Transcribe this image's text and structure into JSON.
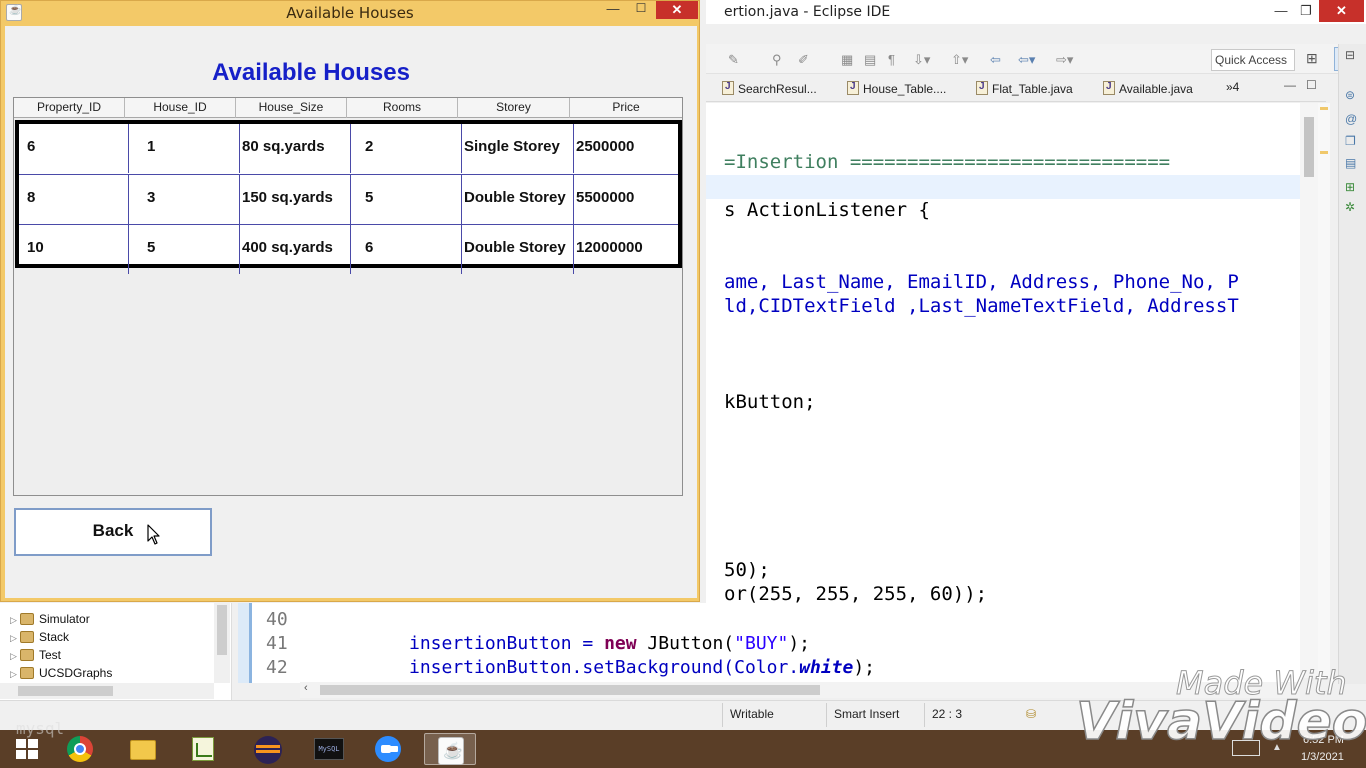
{
  "available_houses_window": {
    "title": "Available Houses",
    "heading": "Available Houses",
    "table": {
      "columns": [
        "Property_ID",
        "House_ID",
        "House_Size",
        "Rooms",
        "Storey",
        "Price"
      ],
      "rows": [
        [
          "6",
          "1",
          "80 sq.yards",
          "2",
          "Single Storey",
          "2500000"
        ],
        [
          "8",
          "3",
          "150 sq.yards",
          "5",
          "Double Storey",
          "5500000"
        ],
        [
          "10",
          "5",
          "400 sq.yards",
          "6",
          "Double Storey",
          "12000000"
        ]
      ]
    },
    "back_label": "Back",
    "controls": {
      "minimize": "—",
      "maximize": "☐",
      "close": "✕"
    }
  },
  "eclipse": {
    "title": "ertion.java - Eclipse IDE",
    "quick_access": "Quick Access",
    "tabs": [
      "SearchResul...",
      "House_Table....",
      "Flat_Table.java",
      "Available.java"
    ],
    "tabs_more": "»4",
    "editor_lines": [
      "=Insertion ============================",
      "s ActionListener {",
      "ame, Last_Name, EmailID, Address, Phone_No, P",
      "ld,CIDTextField ,Last_NameTextField, AddressT",
      "kButton;",
      "50);",
      "or(255, 255, 255, 60));"
    ],
    "bottom_code": {
      "line_numbers": [
        "40",
        "41",
        "42"
      ],
      "line41_a": "insertionButton = ",
      "line41_kw": "new",
      "line41_b": " JButton(",
      "line41_str": "\"BUY\"",
      "line41_c": ");",
      "line42_a": "insertionButton.setBackground(Color.",
      "line42_static": "white",
      "line42_b": ");"
    },
    "package_explorer": [
      "Simulator",
      "Stack",
      "Test",
      "UCSDGraphs"
    ],
    "status": {
      "writable": "Writable",
      "insert_mode": "Smart Insert",
      "position": "22 : 3"
    }
  },
  "taskbar": {
    "clock_time": "6:52 PM",
    "clock_date": "1/3/2021",
    "mysql_label": "MySQL"
  },
  "watermark": {
    "made_with": "Made With",
    "brand": "VivaVideo",
    "overlay": "mysql"
  },
  "colors": {
    "heading_blue": "#1620c8",
    "title_bar": "#f3c968",
    "close_red": "#c7302a",
    "taskbar": "#5a3e27"
  }
}
